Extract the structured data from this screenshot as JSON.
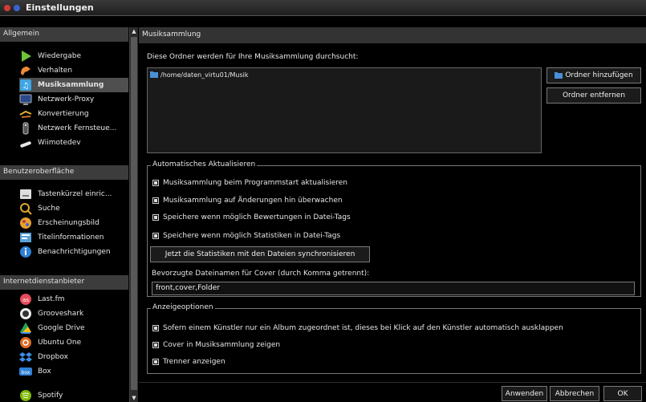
{
  "window": {
    "title": "Einstellungen"
  },
  "sidebar": {
    "groups": [
      {
        "header": "Allgemein",
        "items": [
          {
            "label": "Wiedergabe",
            "icon": "play-icon"
          },
          {
            "label": "Verhalten",
            "icon": "behavior-icon"
          },
          {
            "label": "Musiksammlung",
            "icon": "music-library-icon",
            "selected": true
          },
          {
            "label": "Netzwerk-Proxy",
            "icon": "network-proxy-icon"
          },
          {
            "label": "Konvertierung",
            "icon": "conversion-icon"
          },
          {
            "label": "Netzwerk Fernsteue...",
            "icon": "remote-control-icon"
          },
          {
            "label": "Wiimotedev",
            "icon": "wiimote-icon"
          }
        ]
      },
      {
        "header": "Benutzeroberfläche",
        "items": [
          {
            "label": "Tastenkürzel einric...",
            "icon": "keyboard-icon"
          },
          {
            "label": "Suche",
            "icon": "search-icon"
          },
          {
            "label": "Erscheinungsbild",
            "icon": "appearance-icon"
          },
          {
            "label": "Titelinformationen",
            "icon": "track-info-icon"
          },
          {
            "label": "Benachrichtigungen",
            "icon": "notifications-icon"
          }
        ]
      },
      {
        "header": "Internetdienstanbieter",
        "items": [
          {
            "label": "Last.fm",
            "icon": "lastfm-icon"
          },
          {
            "label": "Grooveshark",
            "icon": "grooveshark-icon"
          },
          {
            "label": "Google Drive",
            "icon": "google-drive-icon"
          },
          {
            "label": "Ubuntu One",
            "icon": "ubuntu-one-icon"
          },
          {
            "label": "Dropbox",
            "icon": "dropbox-icon"
          },
          {
            "label": "Box",
            "icon": "box-icon"
          },
          {
            "label": "Spotify",
            "icon": "spotify-icon"
          }
        ]
      }
    ]
  },
  "page": {
    "header": "Musiksammlung",
    "folders_label": "Diese Ordner werden für Ihre Musiksammlung durchsucht:",
    "folders": [
      "/home/daten_virtu01/Musik"
    ],
    "add_folder_button": "Ordner hinzufügen",
    "remove_folder_button": "Ordner entfernen",
    "auto_update": {
      "legend": "Automatisches Aktualisieren",
      "options": [
        {
          "label": "Musiksammlung beim Programmstart aktualisieren",
          "checked": true
        },
        {
          "label": "Musiksammlung auf Änderungen hin überwachen",
          "checked": true
        },
        {
          "label": "Speichere wenn möglich Bewertungen in Datei-Tags",
          "checked": true
        },
        {
          "label": "Speichere wenn möglich Statistiken in Datei-Tags",
          "checked": true
        }
      ],
      "sync_button": "Jetzt die Statistiken mit den Dateien synchronisieren",
      "cover_label": "Bevorzugte Dateinamen für Cover (durch Komma getrennt):",
      "cover_value": "front,cover,Folder"
    },
    "display": {
      "legend": "Anzeigeoptionen",
      "options": [
        {
          "label": "Sofern einem Künstler nur ein Album zugeordnet ist, dieses bei Klick auf den Künstler automatisch ausklappen",
          "checked": true
        },
        {
          "label": "Cover in Musiksammlung zeigen",
          "checked": true
        },
        {
          "label": "Trenner anzeigen",
          "checked": true
        }
      ]
    }
  },
  "footer": {
    "apply": "Anwenden",
    "cancel": "Abbrechen",
    "ok": "OK"
  }
}
